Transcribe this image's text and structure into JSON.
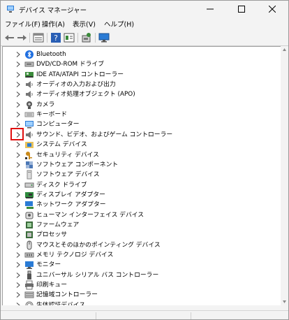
{
  "window": {
    "title": "デバイス マネージャー"
  },
  "menu": [
    "ファイル(F)",
    "操作(A)",
    "表示(V)",
    "ヘルプ(H)"
  ],
  "toolbar_icons": [
    "back-arrow-icon",
    "forward-arrow-icon",
    "properties-icon",
    "help-icon",
    "view-icon",
    "scan-hardware-icon",
    "monitor-icon"
  ],
  "tree": [
    {
      "label": "Bluetooth",
      "icon": "bluetooth-icon",
      "color": "#1f6fe0"
    },
    {
      "label": "DVD/CD-ROM ドライブ",
      "icon": "dvd-drive-icon",
      "color": "#6b6b6b"
    },
    {
      "label": "IDE ATA/ATAPI コントローラー",
      "icon": "ide-controller-icon",
      "color": "#3a8a3a"
    },
    {
      "label": "オーディオの入力および出力",
      "icon": "speaker-icon",
      "color": "#777777"
    },
    {
      "label": "オーディオ処理オブジェクト (APO)",
      "icon": "speaker-icon",
      "color": "#777777"
    },
    {
      "label": "カメラ",
      "icon": "camera-icon",
      "color": "#555555"
    },
    {
      "label": "キーボード",
      "icon": "keyboard-icon",
      "color": "#8a8a8a"
    },
    {
      "label": "コンピューター",
      "icon": "computer-icon",
      "color": "#2a7bd5"
    },
    {
      "label": "サウンド、ビデオ、およびゲーム コントローラー",
      "icon": "sound-icon",
      "color": "#777777"
    },
    {
      "label": "システム デバイス",
      "icon": "system-folder-icon",
      "color": "#2a7bd5"
    },
    {
      "label": "セキュリティ デバイス",
      "icon": "security-key-icon",
      "color": "#c98a1b"
    },
    {
      "label": "ソフトウェア コンポーネント",
      "icon": "software-component-icon",
      "color": "#4b77b5"
    },
    {
      "label": "ソフトウェア デバイス",
      "icon": "software-device-icon",
      "color": "#8a8a8a"
    },
    {
      "label": "ディスク ドライブ",
      "icon": "disk-drive-icon",
      "color": "#6b6b6b"
    },
    {
      "label": "ディスプレイ アダプター",
      "icon": "display-adapter-icon",
      "color": "#2e8b3e"
    },
    {
      "label": "ネットワーク アダプター",
      "icon": "network-adapter-icon",
      "color": "#2a7bd5"
    },
    {
      "label": "ヒューマン インターフェイス デバイス",
      "icon": "hid-icon",
      "color": "#5a5a5a"
    },
    {
      "label": "ファームウェア",
      "icon": "firmware-icon",
      "color": "#3a6b3a"
    },
    {
      "label": "プロセッサ",
      "icon": "processor-icon",
      "color": "#3a6b3a"
    },
    {
      "label": "マウスとそのほかのポインティング デバイス",
      "icon": "mouse-icon",
      "color": "#555555"
    },
    {
      "label": "メモリ テクノロジ デバイス",
      "icon": "memory-icon",
      "color": "#6b6b6b"
    },
    {
      "label": "モニター",
      "icon": "monitor-icon",
      "color": "#2a7bd5"
    },
    {
      "label": "ユニバーサル シリアル バス コントローラー",
      "icon": "usb-icon",
      "color": "#555555"
    },
    {
      "label": "印刷キュー",
      "icon": "printer-icon",
      "color": "#6b6b6b"
    },
    {
      "label": "記憶域コントローラー",
      "icon": "storage-controller-icon",
      "color": "#6b6b6b"
    },
    {
      "label": "生体認証デバイス",
      "icon": "biometric-icon",
      "color": "#6b6b6b"
    }
  ],
  "highlighted_row": 8,
  "highlight_color": "#e01010"
}
